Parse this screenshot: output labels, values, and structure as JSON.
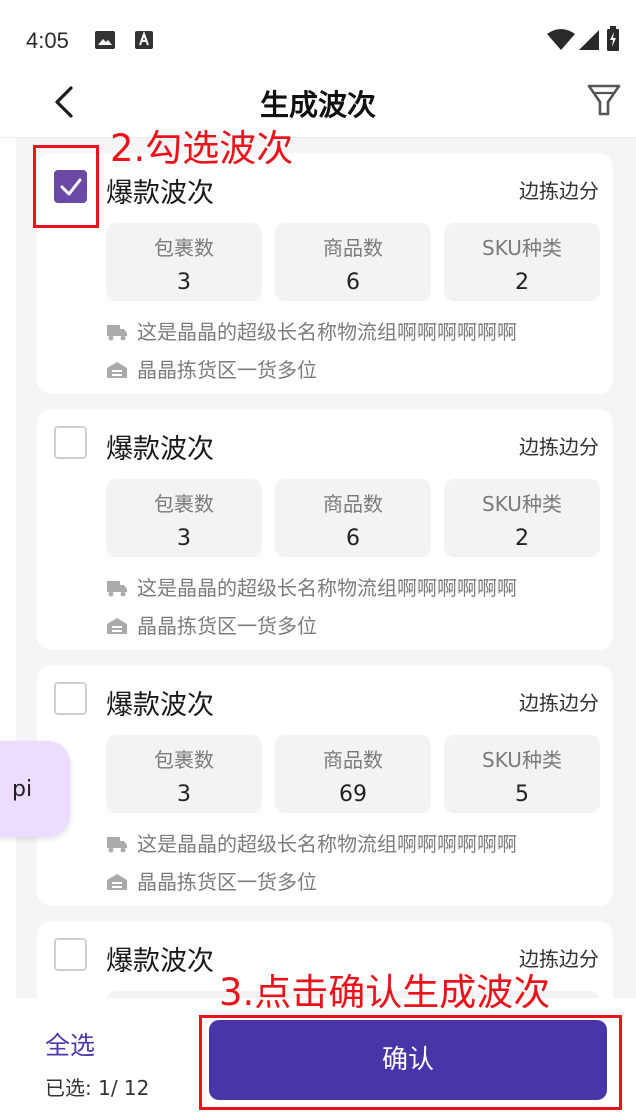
{
  "status_bar": {
    "time": "4:05",
    "icons": [
      "image-icon",
      "a-icon",
      "wifi-icon",
      "signal-icon",
      "battery-icon"
    ]
  },
  "header": {
    "title": "生成波次",
    "back_icon": "chevron-left-icon",
    "filter_icon": "filter-icon"
  },
  "cards": [
    {
      "checked": true,
      "title": "爆款波次",
      "mode": "边拣边分",
      "stats": [
        {
          "label": "包裹数",
          "value": "3"
        },
        {
          "label": "商品数",
          "value": "6"
        },
        {
          "label": "SKU种类",
          "value": "2"
        }
      ],
      "logistics": "这是晶晶的超级长名称物流组啊啊啊啊啊啊",
      "area": "晶晶拣货区一货多位"
    },
    {
      "checked": false,
      "title": "爆款波次",
      "mode": "边拣边分",
      "stats": [
        {
          "label": "包裹数",
          "value": "3"
        },
        {
          "label": "商品数",
          "value": "6"
        },
        {
          "label": "SKU种类",
          "value": "2"
        }
      ],
      "logistics": "这是晶晶的超级长名称物流组啊啊啊啊啊啊",
      "area": "晶晶拣货区一货多位"
    },
    {
      "checked": false,
      "title": "爆款波次",
      "mode": "边拣边分",
      "stats": [
        {
          "label": "包裹数",
          "value": "3"
        },
        {
          "label": "商品数",
          "value": "69"
        },
        {
          "label": "SKU种类",
          "value": "5"
        }
      ],
      "logistics": "这是晶晶的超级长名称物流组啊啊啊啊啊啊",
      "area": "晶晶拣货区一货多位"
    },
    {
      "checked": false,
      "title": "爆款波次",
      "mode": "边拣边分"
    }
  ],
  "float_bubble": {
    "text": "pi"
  },
  "bottom": {
    "select_all": "全选",
    "selected_count": "已选: 1/ 12",
    "confirm": "确认"
  },
  "annotations": {
    "step2": "2.勾选波次",
    "step3": "3.点击确认生成波次",
    "color": "#e8141c"
  },
  "colors": {
    "accent": "#4836a8",
    "checkbox": "#6b4aa6",
    "background": "#f5f5f7"
  }
}
